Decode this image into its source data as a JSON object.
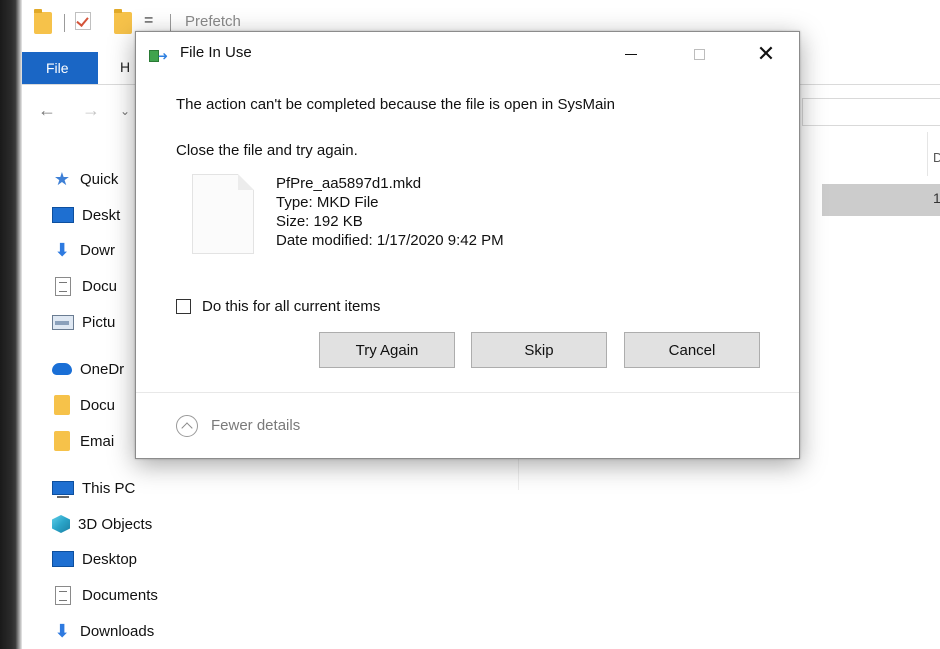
{
  "explorer": {
    "window_title": "Prefetch",
    "ribbon": {
      "file_tab": "File",
      "home_tab_partial": "H"
    },
    "column_header_partial": "D",
    "selected_row_partial": "1",
    "nav": {
      "quick_access": "Quick",
      "desktop": "Deskt",
      "downloads": "Dowr",
      "documents": "Docu",
      "pictures": "Pictu",
      "onedrive": "OneDr",
      "od_documents": "Docu",
      "od_email": "Emai",
      "this_pc": "This PC",
      "objects_3d": "3D Objects",
      "pc_desktop": "Desktop",
      "pc_documents": "Documents",
      "pc_downloads": "Downloads"
    }
  },
  "dialog": {
    "title": "File In Use",
    "message": "The action can't be completed because the file is open in SysMain",
    "instruction": "Close the file and try again.",
    "file": {
      "name": "PfPre_aa5897d1.mkd",
      "type": "Type: MKD File",
      "size": "Size: 192 KB",
      "modified": "Date modified: 1/17/2020 9:42 PM"
    },
    "checkbox_label": "Do this for all current items",
    "buttons": {
      "try_again": "Try Again",
      "skip": "Skip",
      "cancel": "Cancel"
    },
    "details_toggle": "Fewer details",
    "close_glyph": "✕"
  },
  "colors": {
    "file_tab": "#1a66c5",
    "button_bg": "#e1e1e1",
    "dialog_border": "#8c8c8c"
  }
}
